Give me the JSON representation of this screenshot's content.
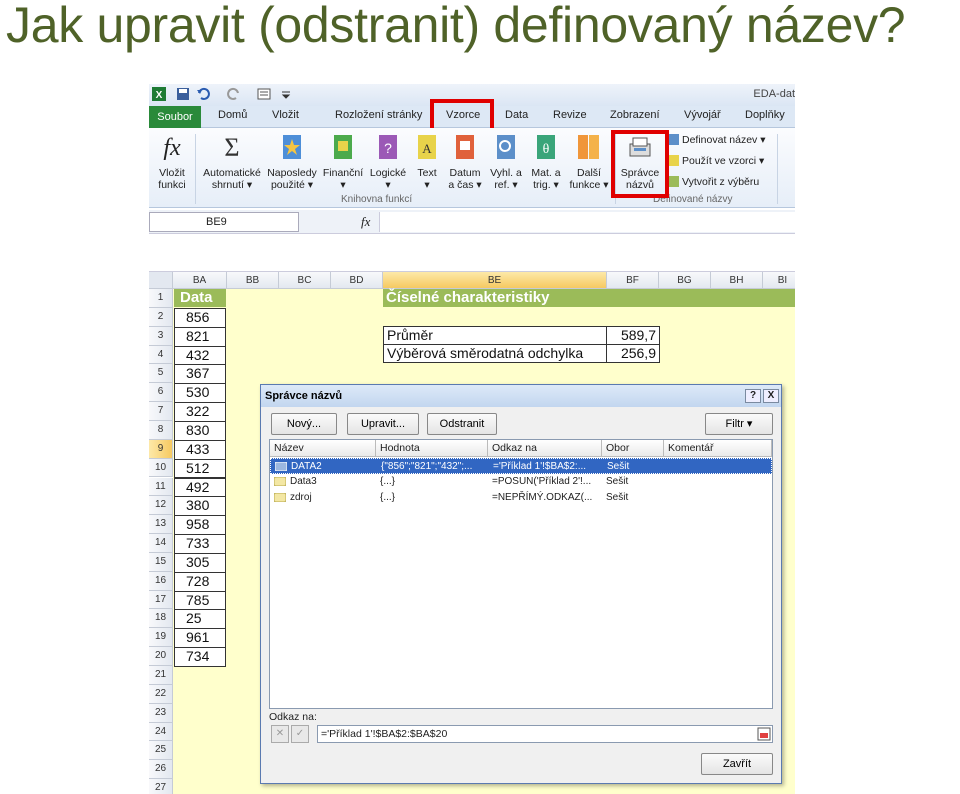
{
  "slide_title": "Jak upravit (odstranit) definovaný název?",
  "app_title": "EDA-dat",
  "tabs": {
    "file": "Soubor",
    "items": [
      "Domů",
      "Vložit",
      "Rozložení stránky",
      "Vzorce",
      "Data",
      "Revize",
      "Zobrazení",
      "Vývojář",
      "Doplňky"
    ]
  },
  "ribbon": {
    "insert_function": [
      "Vložit",
      "funkci"
    ],
    "autosum": [
      "Automatické",
      "shrnutí ▾"
    ],
    "recent": [
      "Naposledy",
      "použité ▾"
    ],
    "financial": [
      "Finanční",
      "▾"
    ],
    "logical": [
      "Logické",
      "▾"
    ],
    "text": [
      "Text",
      "▾"
    ],
    "datetime": [
      "Datum",
      "a čas ▾"
    ],
    "lookup": [
      "Vyhl. a",
      "ref. ▾"
    ],
    "math": [
      "Mat. a",
      "trig. ▾"
    ],
    "more": [
      "Další",
      "funkce ▾"
    ],
    "name_manager": [
      "Správce",
      "názvů"
    ],
    "define_name": "Definovat název ▾",
    "use_in_formula": "Použít ve vzorci ▾",
    "create_from_selection": "Vytvořit z výběru",
    "group_library": "Knihovna funkcí",
    "group_names": "Definované názvy"
  },
  "formula_bar": {
    "name_box": "BE9",
    "fx": "fx"
  },
  "columns": [
    "BA",
    "BB",
    "BC",
    "BD",
    "BE",
    "BF",
    "BG",
    "BH",
    "BI"
  ],
  "rows": [
    "1",
    "2",
    "3",
    "4",
    "5",
    "6",
    "7",
    "8",
    "9",
    "10",
    "11",
    "12",
    "13",
    "14",
    "15",
    "16",
    "17",
    "18",
    "19",
    "20",
    "21",
    "22",
    "23",
    "24",
    "25",
    "26",
    "27"
  ],
  "sheet": {
    "data_header": "Data",
    "values": [
      "856",
      "821",
      "432",
      "367",
      "530",
      "322",
      "830",
      "433",
      "512",
      "492",
      "380",
      "958",
      "733",
      "305",
      "728",
      "785",
      "25",
      "961",
      "734"
    ],
    "stats_header": "Číselné charakteristiky",
    "mean_label": "Průměr",
    "mean_value": "589,7",
    "sd_label": "Výběrová směrodatná odchylka",
    "sd_value": "256,9"
  },
  "dialog": {
    "title": "Správce názvů",
    "help": "?",
    "close": "X",
    "new_btn": "Nový...",
    "edit_btn": "Upravit...",
    "delete_btn": "Odstranit",
    "filter_btn": "Filtr ▾",
    "columns": [
      "Název",
      "Hodnota",
      "Odkaz na",
      "Obor",
      "Komentář"
    ],
    "rows": [
      {
        "name": "DATA2",
        "value": "{\"856\";\"821\";\"432\";...",
        "ref": "='Příklad 1'!$BA$2:...",
        "scope": "Sešit"
      },
      {
        "name": "Data3",
        "value": "{...}",
        "ref": "=POSUN('Příklad 2'!...",
        "scope": "Sešit"
      },
      {
        "name": "zdroj",
        "value": "{...}",
        "ref": "=NEPŘÍMÝ.ODKAZ(...",
        "scope": "Sešit"
      }
    ],
    "ref_label": "Odkaz na:",
    "ref_value": "='Příklad 1'!$BA$2:$BA$20",
    "close_btn": "Zavřít"
  }
}
